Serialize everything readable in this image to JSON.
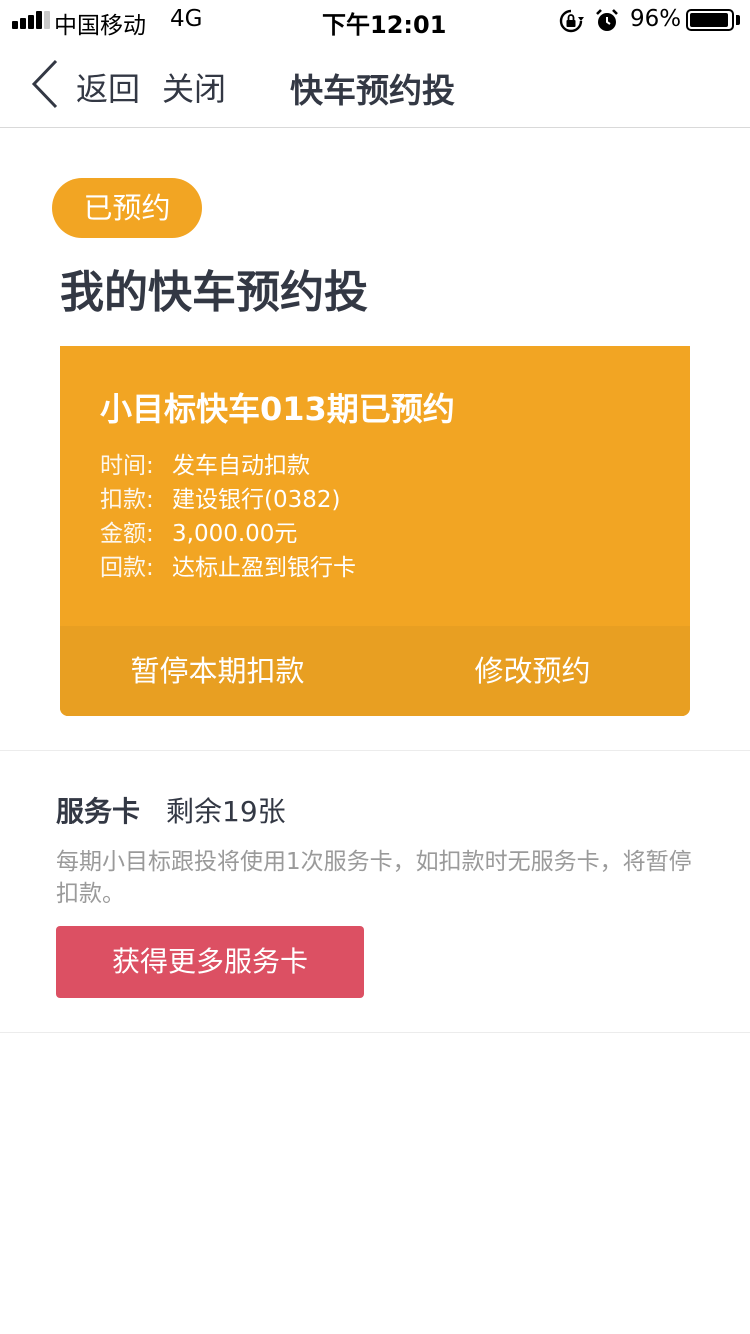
{
  "status_bar": {
    "carrier": "中国移动",
    "network": "4G",
    "time": "下午12:01",
    "battery_percent": "96%",
    "battery_level": 0.96,
    "signal_bars": 4
  },
  "nav": {
    "back_label": "返回",
    "close_label": "关闭",
    "title": "快车预约投"
  },
  "header": {
    "badge": "已预约",
    "title": "我的快车预约投"
  },
  "card": {
    "title": "小目标快车013期已预约",
    "rows": [
      {
        "key": "时间:",
        "value": "发车自动扣款"
      },
      {
        "key": "扣款:",
        "value": "建设银行(0382)"
      },
      {
        "key": "金额:",
        "value": "3,000.00元"
      },
      {
        "key": "回款:",
        "value": "达标止盈到银行卡"
      }
    ],
    "pause_button": "暂停本期扣款",
    "modify_button": "修改预约"
  },
  "service": {
    "title": "服务卡",
    "remaining": "剩余19张",
    "description": "每期小目标跟投将使用1次服务卡，如扣款时无服务卡，将暂停扣款。",
    "button": "获得更多服务卡"
  },
  "colors": {
    "accent_orange": "#f2a523",
    "card_footer": "#e89f22",
    "button_red": "#dc5063",
    "text_dark": "#333844",
    "text_muted": "#9a9a9a"
  }
}
